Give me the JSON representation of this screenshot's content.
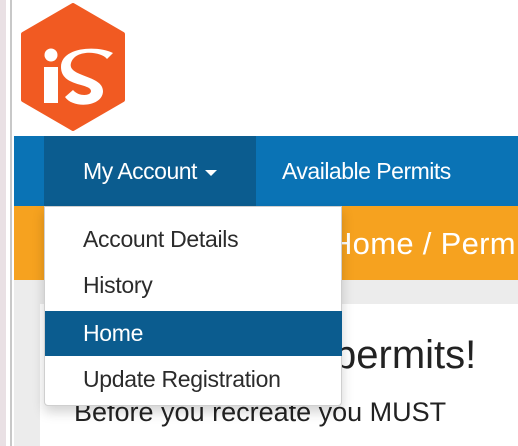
{
  "brand": {
    "logo_text": "iS",
    "colors": {
      "logo": "#f15a22",
      "navbar": "#0a73b5",
      "nav_active": "#0b5c8f",
      "breadcrumb": "#f6a21f"
    }
  },
  "nav": {
    "account_label": "My Account",
    "permits_label": "Available Permits"
  },
  "breadcrumb": {
    "text": "Home  /  Perm"
  },
  "dropdown": {
    "items": [
      {
        "label": "Account Details"
      },
      {
        "label": "History"
      },
      {
        "label": "Home",
        "active": true
      },
      {
        "label": "Update Registration"
      }
    ]
  },
  "content": {
    "heading_fragment": "permits!",
    "subtext_fragment": "Before you recreate you MUST"
  }
}
